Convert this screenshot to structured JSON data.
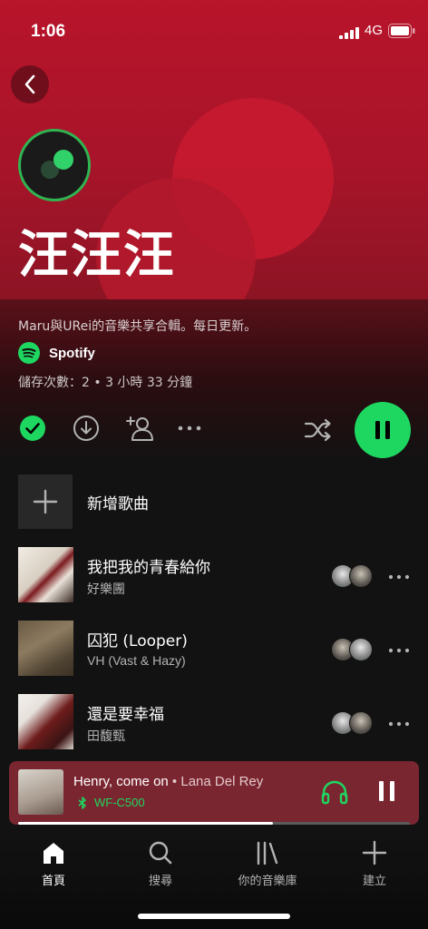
{
  "status_bar": {
    "time": "1:06",
    "network": "4G"
  },
  "playlist": {
    "title": "汪汪汪",
    "description": "Maru與URei的音樂共享合輯。每日更新。",
    "owner": "Spotify",
    "meta": "儲存次數：2 • 3 小時 33 分鐘"
  },
  "add_song_label": "新增歌曲",
  "tracks": [
    {
      "title": "我把我的青春給你",
      "artist": "好樂團"
    },
    {
      "title": "囚犯 (Looper)",
      "artist": "VH (Vast & Hazy)"
    },
    {
      "title": "還是要幸福",
      "artist": "田馥甄"
    }
  ],
  "now_playing": {
    "title": "Henry, come on",
    "separator": " • ",
    "artist": "Lana Del Rey",
    "device": "WF-C500",
    "progress": 0.65
  },
  "tabs": [
    {
      "label": "首頁",
      "icon": "home-icon",
      "active": true
    },
    {
      "label": "搜尋",
      "icon": "search-icon",
      "active": false
    },
    {
      "label": "你的音樂庫",
      "icon": "library-icon",
      "active": false
    },
    {
      "label": "建立",
      "icon": "plus-icon",
      "active": false
    }
  ],
  "colors": {
    "accent": "#1ed760",
    "hero": "#b8142a",
    "miniplayer": "#7a2630"
  }
}
